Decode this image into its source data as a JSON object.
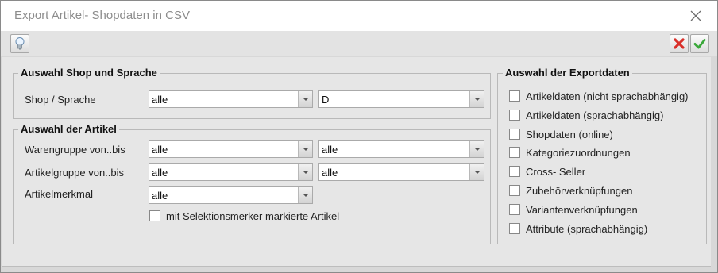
{
  "window": {
    "title": "Export Artikel- Shopdaten in CSV",
    "close_icon": "close-icon"
  },
  "toolbar": {
    "hint_icon": "lightbulb-icon",
    "cancel_icon": "red-x-icon",
    "ok_icon": "green-check-icon",
    "colors": {
      "cancel": "#d9302a",
      "ok": "#3aa83a"
    }
  },
  "shop_group": {
    "legend": "Auswahl Shop und Sprache",
    "shop_label": "Shop / Sprache",
    "shop_value": "alle",
    "language_value": "D"
  },
  "artikel_group": {
    "legend": "Auswahl der Artikel",
    "warengruppe_label": "Warengruppe von..bis",
    "warengruppe_from": "alle",
    "warengruppe_to": "alle",
    "artikelgruppe_label": "Artikelgruppe von..bis",
    "artikelgruppe_from": "alle",
    "artikelgruppe_to": "alle",
    "artikelmerkmal_label": "Artikelmerkmal",
    "artikelmerkmal_value": "alle",
    "selection_checkbox_label": "mit Selektionsmerker markierte Artikel",
    "selection_checked": false
  },
  "export_group": {
    "legend": "Auswahl der Exportdaten",
    "options": [
      {
        "label": "Artikeldaten (nicht sprachabhängig)",
        "checked": false
      },
      {
        "label": "Artikeldaten (sprachabhängig)",
        "checked": false
      },
      {
        "label": "Shopdaten (online)",
        "checked": false
      },
      {
        "label": "Kategoriezuordnungen",
        "checked": false
      },
      {
        "label": "Cross- Seller",
        "checked": false
      },
      {
        "label": "Zubehörverknüpfungen",
        "checked": false
      },
      {
        "label": "Variantenverknüpfungen",
        "checked": false
      },
      {
        "label": "Attribute (sprachabhängig)",
        "checked": false
      }
    ]
  }
}
